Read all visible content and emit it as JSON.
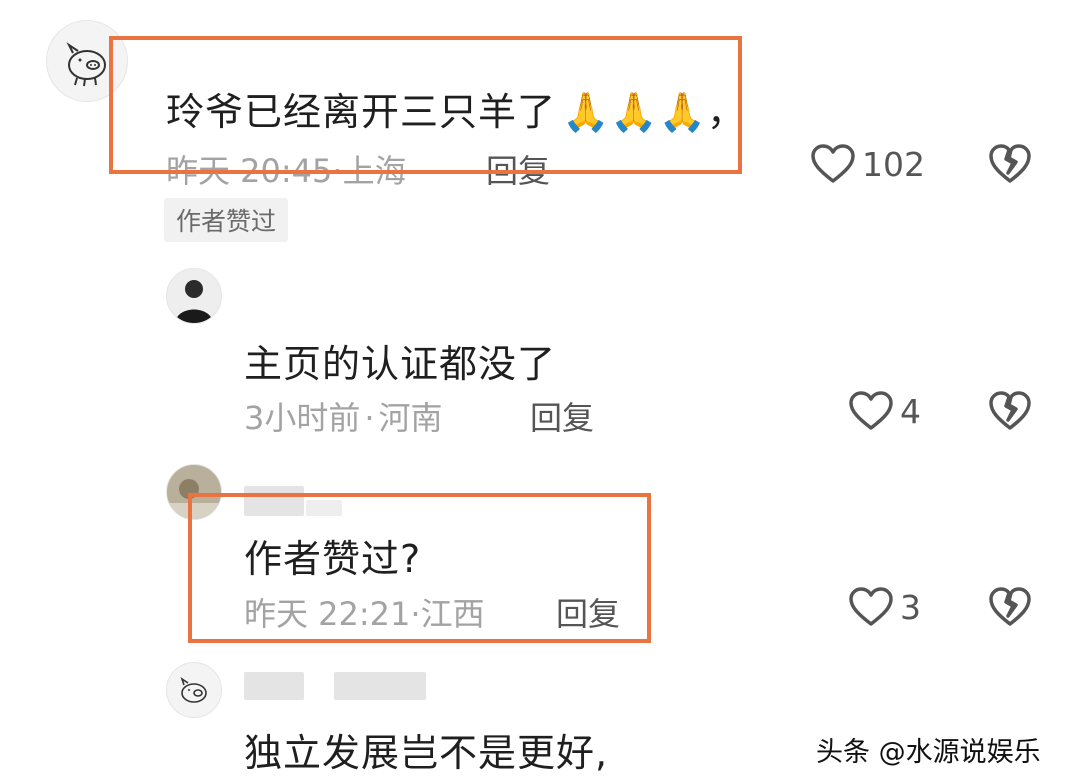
{
  "comments": [
    {
      "text": "玲爷已经离开三只羊了",
      "trailing": "，",
      "emoji": [
        "🙏",
        "🙏",
        "🙏"
      ],
      "time": "昨天 20:45",
      "location": "上海",
      "reply_label": "回复",
      "likes": "102",
      "badge": "作者赞过"
    },
    {
      "text": "主页的认证都没了",
      "time": "3小时前",
      "location": "河南",
      "reply_label": "回复",
      "likes": "4"
    },
    {
      "text": "作者赞过?",
      "time": "昨天 22:21",
      "location": "江西",
      "reply_label": "回复",
      "likes": "3"
    },
    {
      "text": "独立发展岂不是更好,"
    }
  ],
  "separator": "·",
  "watermark": "头条 @水源说娱乐",
  "colors": {
    "highlight": "#ea7342",
    "meta": "#a3a3a3",
    "icon": "#555555"
  }
}
